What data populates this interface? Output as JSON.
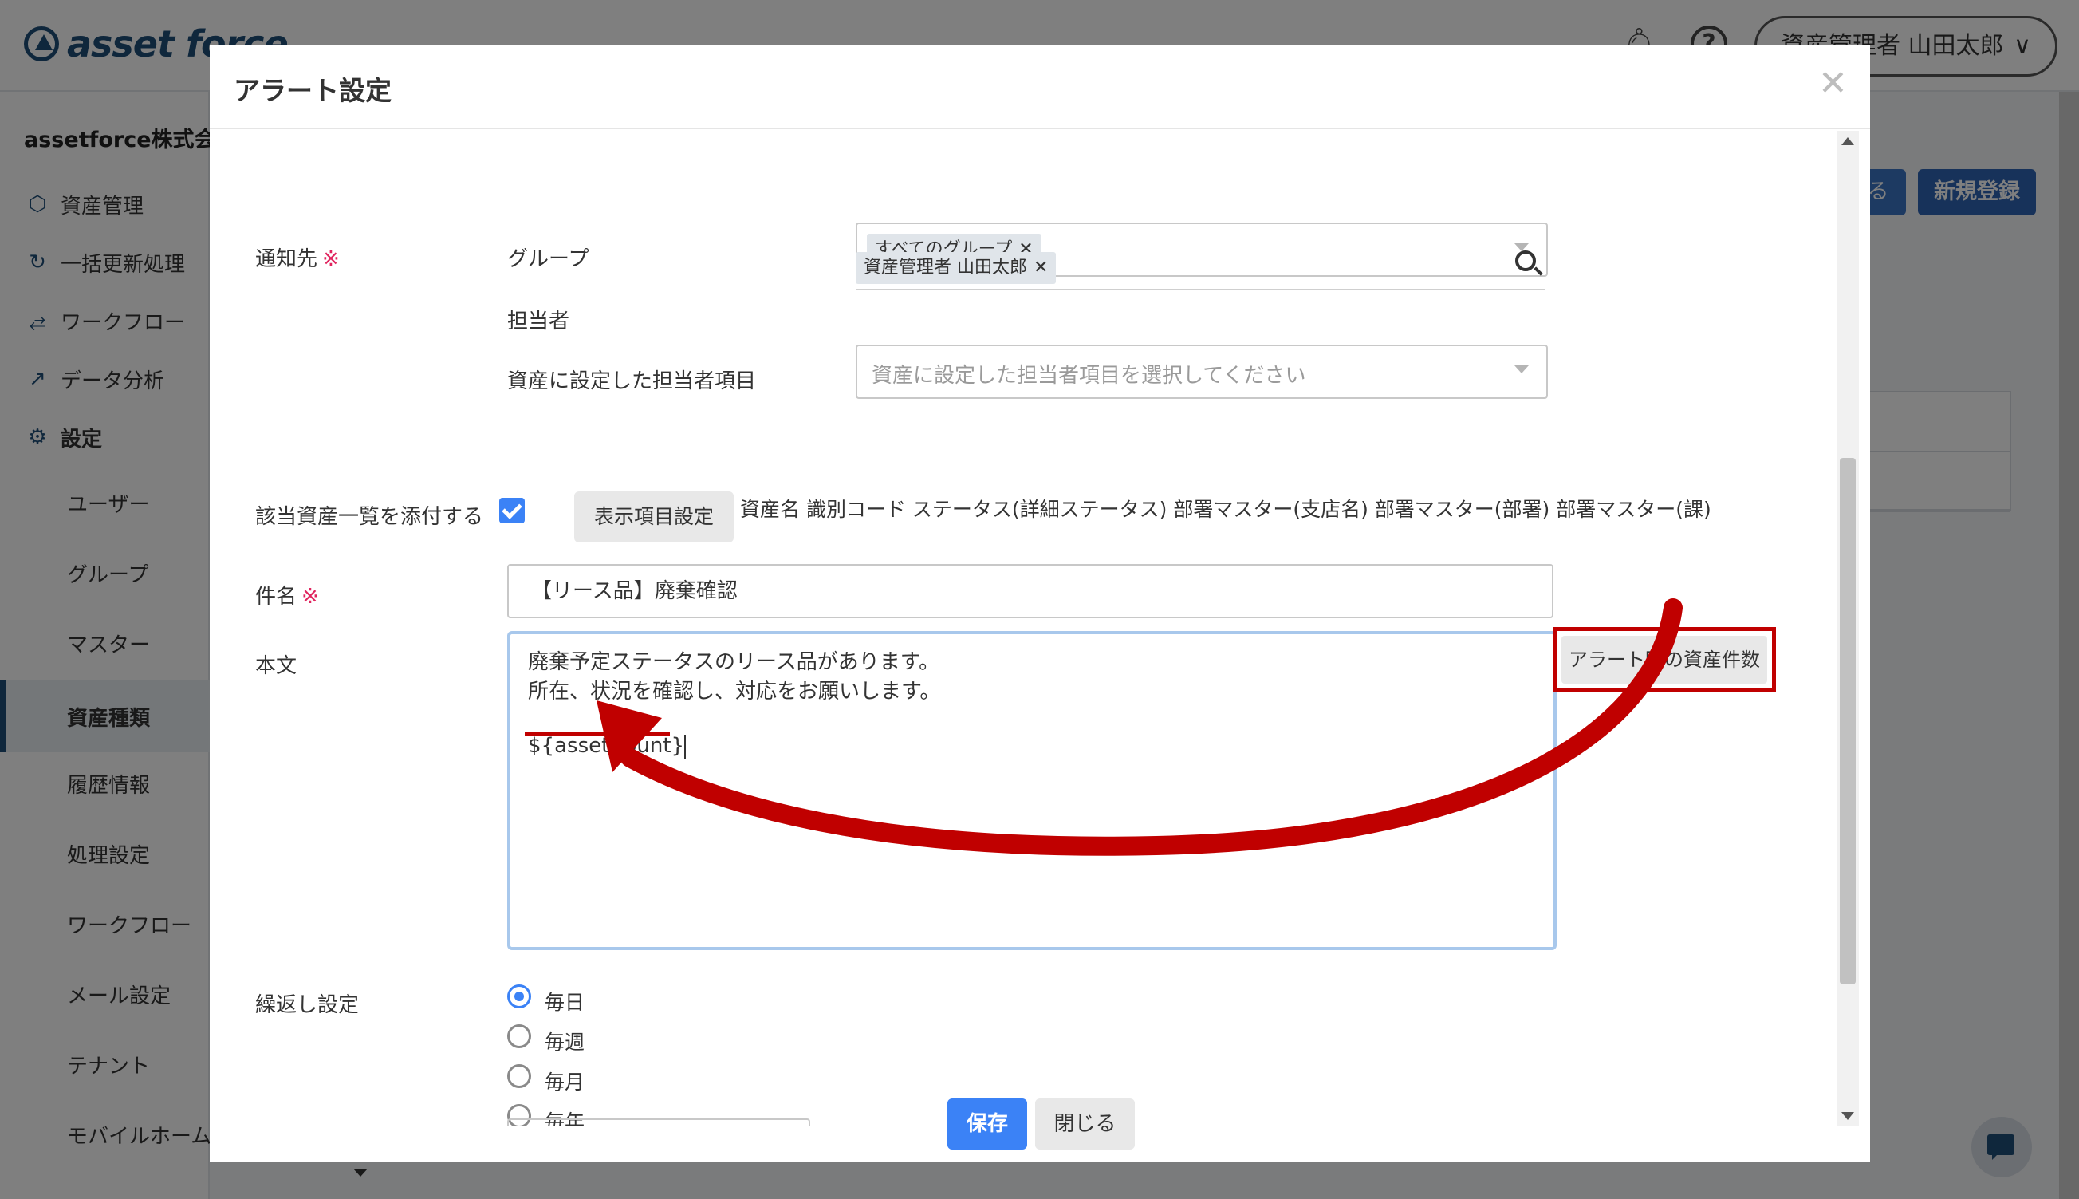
{
  "app": {
    "logo_text": "asset force",
    "user_menu": "資産管理者 山田太郎",
    "company": "assetforce株式会社",
    "nav": [
      {
        "label": "資産管理",
        "icon": "cube-icon"
      },
      {
        "label": "一括更新処理",
        "icon": "refresh-icon"
      },
      {
        "label": "ワークフロー",
        "icon": "workflow-icon"
      },
      {
        "label": "データ分析",
        "icon": "analytics-icon"
      },
      {
        "label": "設定",
        "icon": "gear-icon"
      }
    ],
    "subnav": [
      "ユーザー",
      "グループ",
      "マスター",
      "資産種類",
      "履歴情報",
      "処理設定",
      "ワークフロー",
      "メール設定",
      "テナント",
      "モバイルホーム"
    ],
    "active_subnav": "資産種類",
    "bg_button_partial": "る",
    "bg_button_new": "新規登録"
  },
  "modal": {
    "title": "アラート設定",
    "notify_label": "通知先",
    "required_mark": "※",
    "group_label": "グループ",
    "group_tag": "すべてのグループ",
    "assignee_label": "担当者",
    "assignee_tag": "資産管理者 山田太郎",
    "asset_assignee_label": "資産に設定した担当者項目",
    "asset_assignee_placeholder": "資産に設定した担当者項目を選択してください",
    "attach_label": "該当資産一覧を添付する",
    "attach_checked": true,
    "display_items_button": "表示項目設定",
    "display_columns": "資産名 識別コード ステータス(詳細ステータス) 部署マスター(支店名) 部署マスター(部署) 部署マスター(課)",
    "subject_label": "件名",
    "subject_value": "【リース品】廃棄確認",
    "body_label": "本文",
    "body_lines": [
      "廃棄予定ステータスのリース品があります。",
      "所在、状況を確認し、対応をお願いします。",
      "",
      "${assetCount}"
    ],
    "asset_count_button": "アラート時の資産件数",
    "repeat_label": "繰返し設定",
    "repeat_options": [
      {
        "label": "毎日",
        "checked": true
      },
      {
        "label": "毎週",
        "checked": false
      },
      {
        "label": "毎月",
        "checked": false
      },
      {
        "label": "毎年",
        "checked": false
      }
    ],
    "save_button": "保存",
    "close_button": "閉じる"
  },
  "colors": {
    "primary": "#3b82f6",
    "brand": "#1f4e79",
    "highlight_red": "#c00000",
    "required_pink": "#e0245e"
  }
}
